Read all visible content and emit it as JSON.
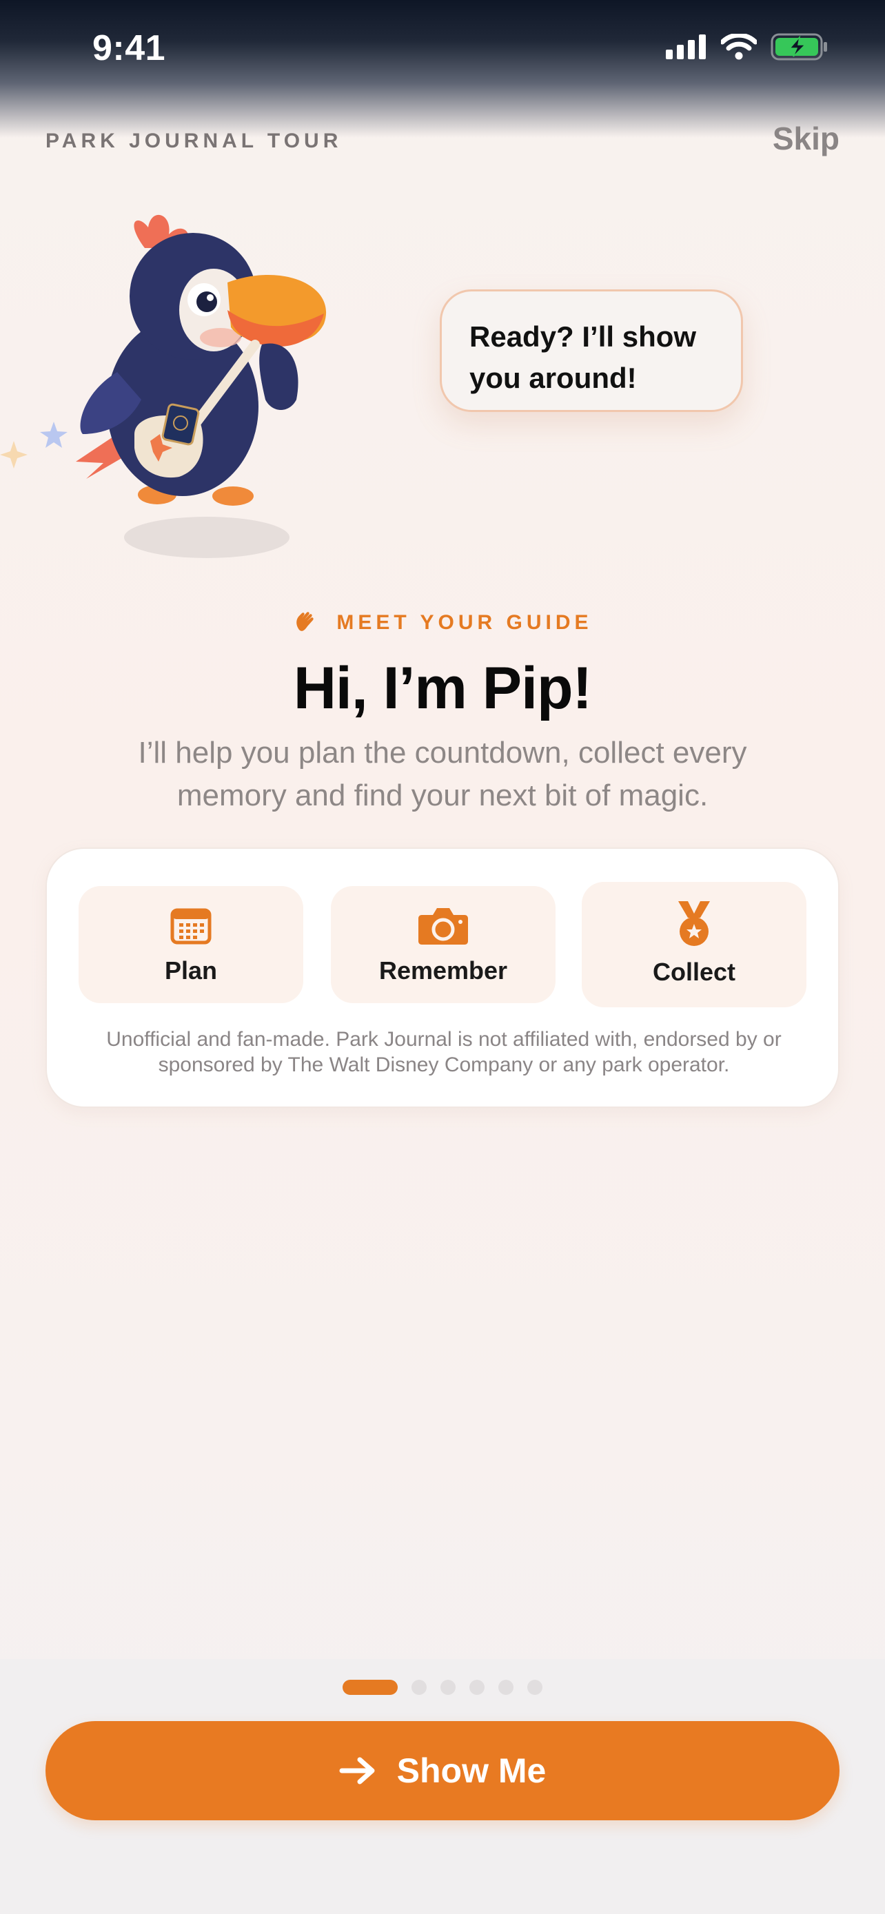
{
  "status_bar": {
    "time": "9:41"
  },
  "header": {
    "title": "PARK JOURNAL TOUR",
    "skip_label": "Skip"
  },
  "mascot": {
    "speech": "Ready? I’ll show you around!"
  },
  "intro": {
    "eyebrow": "MEET YOUR GUIDE",
    "title": "Hi, I’m Pip!",
    "subtitle": "I’ll help you plan the countdown, collect every memory and find your next bit of magic."
  },
  "features": [
    {
      "label": "Plan",
      "icon": "calendar-icon"
    },
    {
      "label": "Remember",
      "icon": "camera-icon"
    },
    {
      "label": "Collect",
      "icon": "medal-icon"
    }
  ],
  "disclaimer": "Unofficial and fan-made. Park Journal is not affiliated with, endorsed by or sponsored by The Walt Disney Company or any park operator.",
  "pager": {
    "current": 1,
    "total": 6
  },
  "cta": {
    "label": "Show Me",
    "icon": "arrow-right-icon"
  },
  "colors": {
    "accent": "#E87A22",
    "background": "#F8F2EF",
    "text": "#0A0A0A",
    "muted": "#8D8786"
  }
}
